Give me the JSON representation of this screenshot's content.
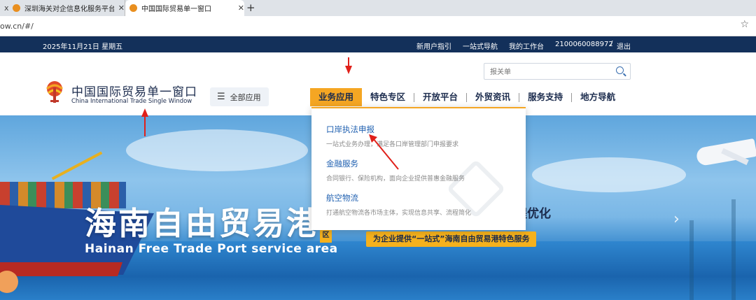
{
  "browser": {
    "tabs": [
      {
        "label": "x",
        "active": false
      },
      {
        "label": "深圳海关对企信息化服务平台（表",
        "active": false
      },
      {
        "label": "中国国际贸易单一窗口",
        "active": true
      }
    ],
    "new_tab": "+",
    "url": "ow.cn/#/",
    "bookmark_icon": "star-icon"
  },
  "topbar": {
    "date": "2025年11月21日 星期五",
    "links": [
      "新用户指引",
      "一站式导航",
      "我的工作台"
    ],
    "account": "2100060088972",
    "separator": "/",
    "logout": "退出",
    "bg_color": "#13305a"
  },
  "header": {
    "logo_cn": "中国国际贸易单一窗口",
    "logo_en": "China International Trade Single Window",
    "all_apps": "全部应用",
    "search_placeholder": "报关单",
    "nav": [
      {
        "label": "业务应用",
        "active": true
      },
      {
        "label": "特色专区",
        "active": false
      },
      {
        "label": "开放平台",
        "active": false
      },
      {
        "label": "外贸资讯",
        "active": false
      },
      {
        "label": "服务支持",
        "active": false
      },
      {
        "label": "地方导航",
        "active": false
      }
    ],
    "accent_color": "#f5a623"
  },
  "dropdown": {
    "items": [
      {
        "title": "口岸执法申报",
        "desc": "一站式业务办理，满足各口岸管理部门申报要求"
      },
      {
        "title": "金融服务",
        "desc": "合同银行、保险机构，面向企业提供普惠金融服务"
      },
      {
        "title": "航空物流",
        "desc": "打通航空物流各市场主体，实现信息共享、流程简化"
      }
    ]
  },
  "hero": {
    "title_cn": "海南自由贸易港",
    "title_en": "Hainan Free Trade Port service area",
    "right_text": "程优化",
    "badge": "为企业提供“一站式”海南自由贸易港特色服务",
    "left_tag": "区",
    "next_arrow": "›"
  }
}
